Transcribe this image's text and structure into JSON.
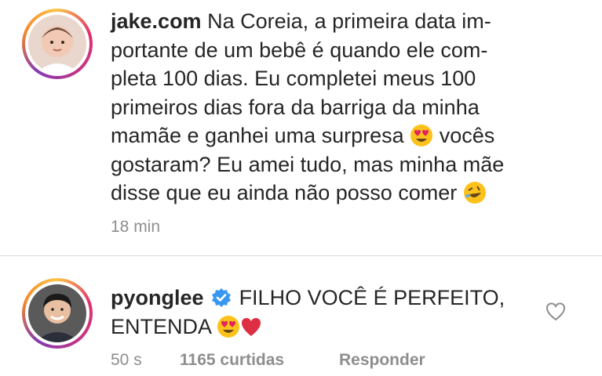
{
  "comment1": {
    "username": "jake.com",
    "lines": [
      "Na Coreia, a primeira data im-",
      "portante de um bebê é quando ele com-",
      "pleta 100 dias. Eu completei meus 100",
      "primeiros dias fora da barriga da minha",
      "mamãe e ganhei uma surpresa",
      "vocês",
      "gostaram? Eu amei tudo, mas minha mãe",
      "disse que eu ainda não posso comer"
    ],
    "time": "18 min",
    "emojis": [
      "heart-eyes-emoji",
      "rolling-laughing-emoji"
    ]
  },
  "comment2": {
    "username": "pyonglee",
    "text_line1": "FILHO VOCÊ É PERFEITO,",
    "text_line2": "ENTENDA",
    "time": "50 s",
    "likes": "1165 curtidas",
    "reply": "Responder",
    "icons": [
      "verified-badge-icon",
      "heart-eyes-emoji",
      "red-heart-emoji",
      "like-heart-icon"
    ]
  },
  "colors": {
    "text": "#262626",
    "meta": "#8e8e8e",
    "verified": "#3897f0",
    "heart": "#e0245e",
    "divider": "#dbdbdb"
  }
}
